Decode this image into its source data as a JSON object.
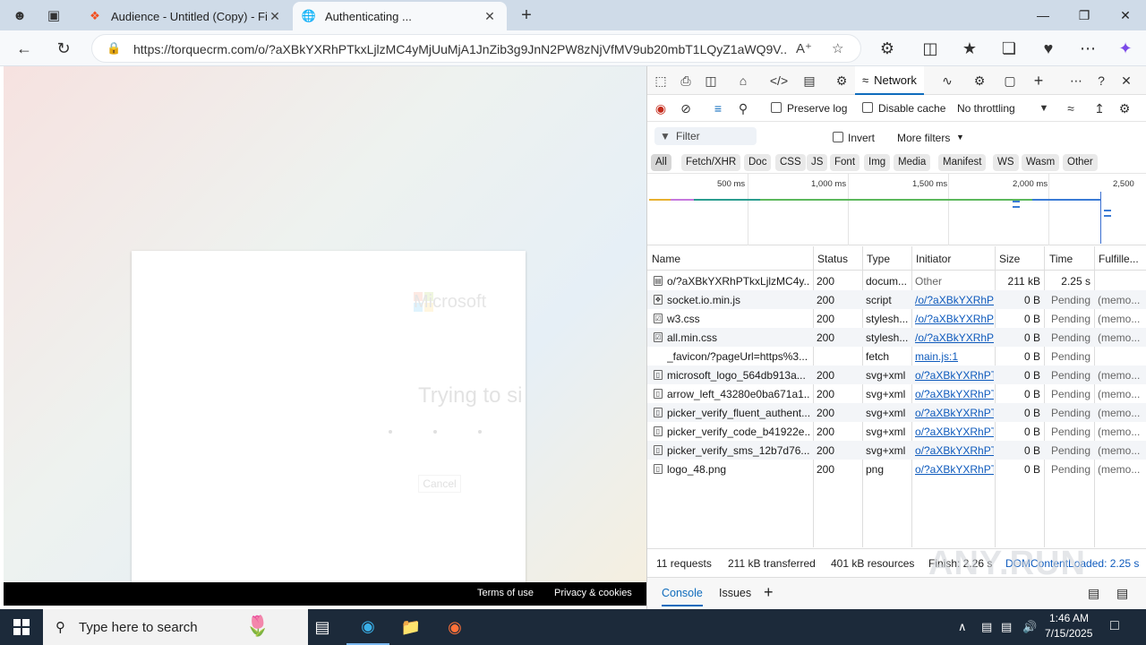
{
  "browser": {
    "tabs": [
      {
        "label": "Audience - Untitled (Copy) - Figm",
        "active": false
      },
      {
        "label": "Authenticating ...",
        "active": true
      }
    ],
    "url": "https://torquecrm.com/o/?aXBkYXRhPTkxLjlzMC4yMjUuMjA1JnZib3g9JnN2PW8zNjVfMV9ub20mbT1LQyZ1aWQ9V..."
  },
  "page": {
    "logo_text": "Microsoft",
    "title": "Trying to si",
    "cancel": "Cancel",
    "footer_terms": "Terms of use",
    "footer_privacy": "Privacy & cookies"
  },
  "devtools": {
    "active_tab": "Network",
    "preserve_log": "Preserve log",
    "disable_cache": "Disable cache",
    "throttling": "No throttling",
    "filter_placeholder": "Filter",
    "invert": "Invert",
    "more_filters": "More filters",
    "type_filters": [
      "All",
      "Fetch/XHR",
      "Doc",
      "CSS",
      "JS",
      "Font",
      "Img",
      "Media",
      "Manifest",
      "WS",
      "Wasm",
      "Other"
    ],
    "timeline_labels": [
      "500 ms",
      "1,000 ms",
      "1,500 ms",
      "2,000 ms",
      "2,500"
    ],
    "columns": [
      "Name",
      "Status",
      "Type",
      "Initiator",
      "Size",
      "Time",
      "Fulfille..."
    ],
    "rows": [
      {
        "name": "o/?aXBkYXRhPTkxLjlzMC4y...",
        "status": "200",
        "type": "docum...",
        "initiator": "Other",
        "init_link": false,
        "size": "211 kB",
        "time": "2.25 s",
        "fulfilled": ""
      },
      {
        "name": "socket.io.min.js",
        "status": "200",
        "type": "script",
        "initiator": "/o/?aXBkYXRhPT",
        "init_link": true,
        "size": "0 B",
        "time": "Pending",
        "fulfilled": "(memo..."
      },
      {
        "name": "w3.css",
        "status": "200",
        "type": "stylesh...",
        "initiator": "/o/?aXBkYXRhPT",
        "init_link": true,
        "size": "0 B",
        "time": "Pending",
        "fulfilled": "(memo..."
      },
      {
        "name": "all.min.css",
        "status": "200",
        "type": "stylesh...",
        "initiator": "/o/?aXBkYXRhPT",
        "init_link": true,
        "size": "0 B",
        "time": "Pending",
        "fulfilled": "(memo..."
      },
      {
        "name": "_favicon/?pageUrl=https%3...",
        "status": "",
        "type": "fetch",
        "initiator": "main.js:1",
        "init_link": true,
        "size": "0 B",
        "time": "Pending",
        "fulfilled": ""
      },
      {
        "name": "microsoft_logo_564db913a...",
        "status": "200",
        "type": "svg+xml",
        "initiator": "o/?aXBkYXRhPTk",
        "init_link": true,
        "size": "0 B",
        "time": "Pending",
        "fulfilled": "(memo..."
      },
      {
        "name": "arrow_left_43280e0ba671a1...",
        "status": "200",
        "type": "svg+xml",
        "initiator": "o/?aXBkYXRhPTk",
        "init_link": true,
        "size": "0 B",
        "time": "Pending",
        "fulfilled": "(memo..."
      },
      {
        "name": "picker_verify_fluent_authent...",
        "status": "200",
        "type": "svg+xml",
        "initiator": "o/?aXBkYXRhPTk",
        "init_link": true,
        "size": "0 B",
        "time": "Pending",
        "fulfilled": "(memo..."
      },
      {
        "name": "picker_verify_code_b41922e...",
        "status": "200",
        "type": "svg+xml",
        "initiator": "o/?aXBkYXRhPTk",
        "init_link": true,
        "size": "0 B",
        "time": "Pending",
        "fulfilled": "(memo..."
      },
      {
        "name": "picker_verify_sms_12b7d76...",
        "status": "200",
        "type": "svg+xml",
        "initiator": "o/?aXBkYXRhPTk",
        "init_link": true,
        "size": "0 B",
        "time": "Pending",
        "fulfilled": "(memo..."
      },
      {
        "name": "logo_48.png",
        "status": "200",
        "type": "png",
        "initiator": "o/?aXBkYXRhPTk",
        "init_link": true,
        "size": "0 B",
        "time": "Pending",
        "fulfilled": "(memo..."
      }
    ],
    "status_bar": {
      "requests": "11 requests",
      "transferred": "211 kB transferred",
      "resources": "401 kB resources",
      "finish": "Finish: 2.26 s",
      "domcontent": "DOMContentLoaded: 2.25 s"
    },
    "drawer_tabs": [
      "Console",
      "Issues"
    ]
  },
  "taskbar": {
    "search_placeholder": "Type here to search",
    "time": "1:46 AM",
    "date": "7/15/2025"
  },
  "watermark": "ANY.RUN"
}
